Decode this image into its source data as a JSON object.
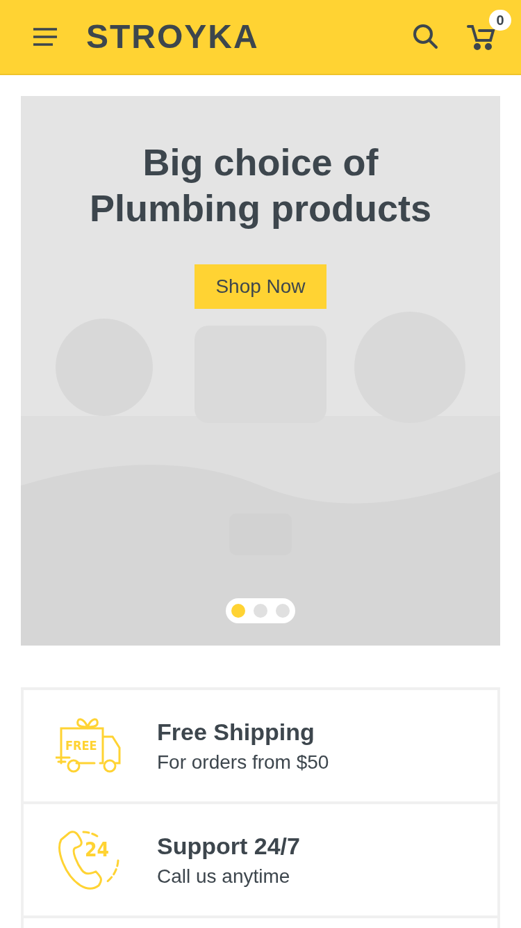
{
  "header": {
    "logo": "STROYKA",
    "cart_count": "0"
  },
  "slide": {
    "kind": "picture",
    "title_lines": [
      "Big choice of",
      "Plumbing products"
    ],
    "button": "Shop Now",
    "dots": [
      {
        "selected": true
      },
      {
        "selected": false
      },
      {
        "selected": false
      }
    ]
  },
  "features": [
    {
      "kind": "shipping",
      "icon_text": "FREE",
      "title": "Free Shipping",
      "subtitle": "For orders from $50"
    },
    {
      "kind": "support",
      "icon_text": "24",
      "title": "Support 24/7",
      "subtitle": "Call us anytime"
    },
    {
      "kind": "empty"
    }
  ]
}
